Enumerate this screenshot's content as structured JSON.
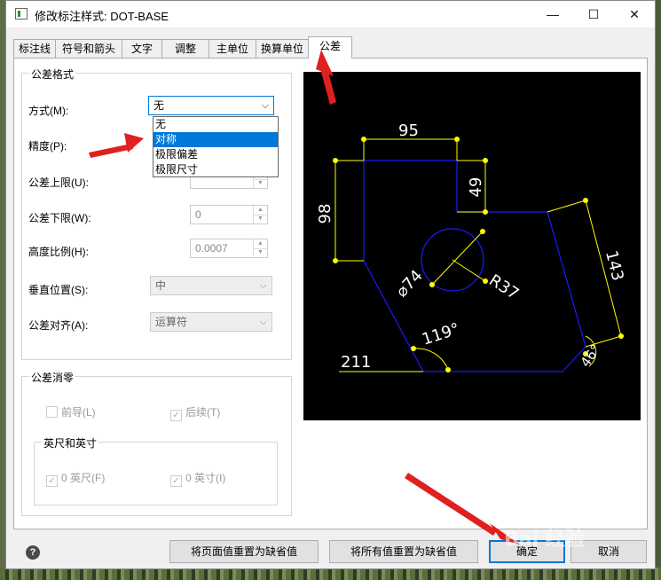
{
  "window": {
    "title": "修改标注样式: DOT-BASE",
    "minimize_glyph": "—",
    "maximize_glyph": "☐",
    "close_glyph": "✕"
  },
  "tabs": [
    {
      "label": "标注线"
    },
    {
      "label": "符号和箭头"
    },
    {
      "label": "文字"
    },
    {
      "label": "调整"
    },
    {
      "label": "主单位"
    },
    {
      "label": "换算单位"
    },
    {
      "label": "公差",
      "active": true
    }
  ],
  "tolerance_format": {
    "group_title": "公差格式",
    "method": {
      "label": "方式(M):",
      "value": "无"
    },
    "precision": {
      "label": "精度(P):"
    },
    "upper": {
      "label": "公差上限(U):",
      "value": ""
    },
    "lower": {
      "label": "公差下限(W):",
      "value": "0"
    },
    "height_scale": {
      "label": "高度比例(H):",
      "value": "0.0007"
    },
    "vertical_position": {
      "label": "垂直位置(S):",
      "value": "中"
    },
    "alignment": {
      "label": "公差对齐(A):",
      "value": "运算符"
    }
  },
  "method_dropdown": {
    "options": [
      "无",
      "对称",
      "极限偏差",
      "极限尺寸"
    ],
    "highlighted": "对称"
  },
  "zero_suppression": {
    "group_title": "公差消零",
    "leading": {
      "label": "前导(L)",
      "checked": false
    },
    "trailing": {
      "label": "后续(T)",
      "checked": true
    },
    "feet_inches": {
      "title": "英尺和英寸",
      "feet": {
        "label": "0 英尺(F)",
        "checked": true
      },
      "inches": {
        "label": "0 英寸(I)",
        "checked": true
      }
    }
  },
  "preview": {
    "dims": {
      "d95": "95",
      "d49": "49",
      "d98": "98",
      "d143": "143",
      "d74": "⌀74",
      "r37": "R37",
      "a119": "119°",
      "a46": "46°",
      "d211": "211"
    }
  },
  "buttons": {
    "help": "?",
    "reset_page": "将页面值重置为缺省值",
    "reset_all": "将所有值重置为缺省值",
    "ok": "确定",
    "cancel": "取消"
  },
  "colors": {
    "accent": "#0078d7",
    "arrow": "#e0201f",
    "drawing_geometry": "#1a1aff",
    "drawing_dims": "#ffff00"
  },
  "watermark": "Bai 经验"
}
